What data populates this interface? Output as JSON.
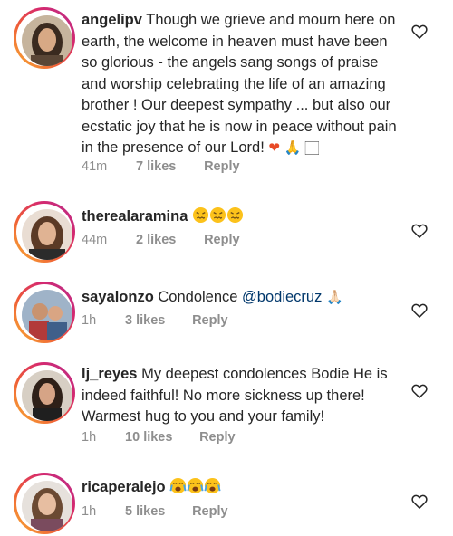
{
  "comments": [
    {
      "username": "angelipv",
      "text": "Though we grieve and mourn here on earth, the welcome in heaven must have been so glorious - the angels sang songs of praise and worship celebrating the life of an amazing brother ! Our deepest sympathy ... but also our ecstatic joy that he is now in peace without pain in the presence of our Lord!",
      "emoji": [
        "❤",
        "🙏",
        "🏻"
      ],
      "time": "41m",
      "likes": "7 likes",
      "reply": "Reply"
    },
    {
      "username": "therealaramina",
      "text": "",
      "emoji": [
        "😖",
        "😖",
        "😖"
      ],
      "time": "44m",
      "likes": "2 likes",
      "reply": "Reply"
    },
    {
      "username": "sayalonzo",
      "text": "Condolence",
      "mention": "@bodiecruz",
      "emoji": [
        "🙏",
        "🏻"
      ],
      "time": "1h",
      "likes": "3 likes",
      "reply": "Reply"
    },
    {
      "username": "lj_reyes",
      "text": "My deepest condolences Bodie He is indeed faithful! No more sickness up there! Warmest hug to you and your family!",
      "time": "1h",
      "likes": "10 likes",
      "reply": "Reply"
    },
    {
      "username": "ricaperalejo",
      "text": "",
      "emoji": [
        "😭",
        "😭",
        "😭"
      ],
      "time": "1h",
      "likes": "5 likes",
      "reply": "Reply"
    }
  ],
  "icons": {
    "like": "heart-outline-icon"
  },
  "colors": {
    "text": "#262626",
    "meta": "#8e8e8e",
    "mention": "#00376b",
    "ring_start": "#f9b233",
    "ring_end": "#b42f8f"
  }
}
